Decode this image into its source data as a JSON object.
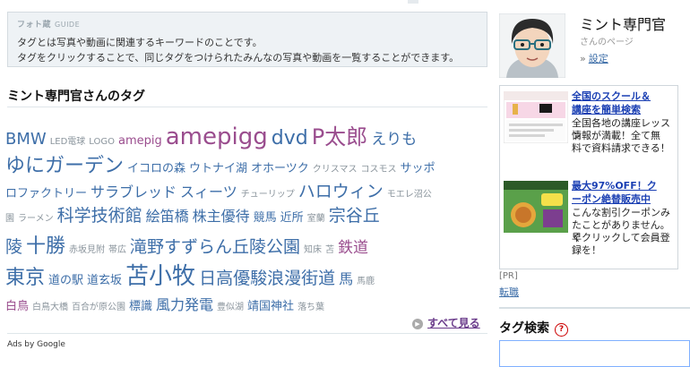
{
  "guide": {
    "title": "フォト蔵",
    "subtitle": "GUIDE",
    "line1": "タグとは写真や動画に関連するキーワードのことです。",
    "line2": "タグをクリックすることで、同じタグをつけられたみんなの写真や動画を一覧することができます。"
  },
  "tags_section": {
    "title": "ミント専門官さんのタグ",
    "more_label": "すべて見る"
  },
  "tags": [
    [
      {
        "t": "BMW",
        "s": 18,
        "c": "blue"
      },
      {
        "t": "LED電球",
        "s": 10,
        "c": "grey"
      },
      {
        "t": "LOGO",
        "s": 10,
        "c": "grey"
      },
      {
        "t": "amepig",
        "s": 13,
        "c": "purple"
      },
      {
        "t": "amepigg",
        "s": 26,
        "c": "purple"
      },
      {
        "t": "dvd",
        "s": 22,
        "c": "blue"
      },
      {
        "t": "P太郎",
        "s": 24,
        "c": "purple"
      },
      {
        "t": "えりも",
        "s": 17,
        "c": "blue"
      }
    ],
    [
      {
        "t": "ゆにガーデン",
        "s": 22,
        "c": "blue"
      },
      {
        "t": "イコロの森",
        "s": 13,
        "c": "blue"
      },
      {
        "t": "ウトナイ湖",
        "s": 13,
        "c": "blue"
      },
      {
        "t": "オホーツク",
        "s": 13,
        "c": "blue"
      },
      {
        "t": "クリスマス",
        "s": 10,
        "c": "grey"
      },
      {
        "t": "コスモス",
        "s": 10,
        "c": "grey"
      },
      {
        "t": "サッポ",
        "s": 13,
        "c": "blue"
      }
    ],
    [
      {
        "t": "ロファクトリー",
        "s": 13,
        "c": "blue"
      },
      {
        "t": "サラブレッド",
        "s": 16,
        "c": "blue"
      },
      {
        "t": "スィーツ",
        "s": 16,
        "c": "blue"
      },
      {
        "t": "チューリップ",
        "s": 10,
        "c": "grey"
      },
      {
        "t": "ハロウィン",
        "s": 19,
        "c": "blue"
      },
      {
        "t": "モエレ沼公",
        "s": 10,
        "c": "grey"
      }
    ],
    [
      {
        "t": "園",
        "s": 10,
        "c": "grey"
      },
      {
        "t": "ラーメン",
        "s": 10,
        "c": "grey"
      },
      {
        "t": "科学技術館",
        "s": 19,
        "c": "blue"
      },
      {
        "t": "絵笛橋",
        "s": 16,
        "c": "blue"
      },
      {
        "t": "株主優待",
        "s": 16,
        "c": "blue"
      },
      {
        "t": "競馬",
        "s": 13,
        "c": "blue"
      },
      {
        "t": "近所",
        "s": 13,
        "c": "blue"
      },
      {
        "t": "室蘭",
        "s": 10,
        "c": "grey"
      },
      {
        "t": "宗谷丘",
        "s": 19,
        "c": "blue"
      }
    ],
    [
      {
        "t": "陵",
        "s": 19,
        "c": "blue"
      },
      {
        "t": "十勝",
        "s": 22,
        "c": "blue"
      },
      {
        "t": "赤坂見附",
        "s": 10,
        "c": "grey"
      },
      {
        "t": "帯広",
        "s": 10,
        "c": "grey"
      },
      {
        "t": "滝野すずらん丘陵公園",
        "s": 19,
        "c": "blue"
      },
      {
        "t": "知床",
        "s": 10,
        "c": "grey"
      },
      {
        "t": "苫",
        "s": 10,
        "c": "grey"
      },
      {
        "t": "鉄道",
        "s": 17,
        "c": "purple"
      }
    ],
    [
      {
        "t": "東京",
        "s": 22,
        "c": "blue"
      },
      {
        "t": "道の駅",
        "s": 13,
        "c": "blue"
      },
      {
        "t": "道玄坂",
        "s": 13,
        "c": "blue"
      },
      {
        "t": "苫小牧",
        "s": 26,
        "c": "blue"
      },
      {
        "t": "日高優駿浪漫街道",
        "s": 19,
        "c": "blue"
      },
      {
        "t": "馬",
        "s": 16,
        "c": "blue"
      },
      {
        "t": "馬鹿",
        "s": 10,
        "c": "grey"
      }
    ],
    [
      {
        "t": "白鳥",
        "s": 13,
        "c": "purple"
      },
      {
        "t": "白鳥大橋",
        "s": 10,
        "c": "grey"
      },
      {
        "t": "百合が原公園",
        "s": 10,
        "c": "grey"
      },
      {
        "t": "標識",
        "s": 13,
        "c": "blue"
      },
      {
        "t": "風力発電",
        "s": 16,
        "c": "blue"
      },
      {
        "t": "豊似湖",
        "s": 10,
        "c": "grey"
      },
      {
        "t": "靖国神社",
        "s": 13,
        "c": "blue"
      },
      {
        "t": "落ち葉",
        "s": 10,
        "c": "grey"
      }
    ]
  ],
  "ads_by_google": "Ads by Google",
  "user": {
    "name": "ミント専門官",
    "page_label": "さんのページ",
    "settings_label": "設定"
  },
  "ads": [
    {
      "title_l1": "全国のスクール＆",
      "title_l2": "講座を簡単検索",
      "body": [
        "全国各地の講座レッスン",
        "情報が満載！全て無",
        "料で資料請求できる！"
      ]
    },
    {
      "title_l1": "最大97%OFF！ク",
      "title_l2": "ーポン絶替販売中",
      "body": [
        "こんな割引クーポンみ",
        "たことがありません。早",
        "くクリックして会員登",
        "録を！"
      ]
    }
  ],
  "pr": {
    "label": "[PR]",
    "link": "転職"
  },
  "tag_search": {
    "title": "タグ検索",
    "help": "?"
  },
  "colors": {
    "tag_blue": "#3d6ea8",
    "tag_purple": "#9a4d8e",
    "tag_grey": "#8a949c",
    "ad_link": "#1a3fb3"
  }
}
